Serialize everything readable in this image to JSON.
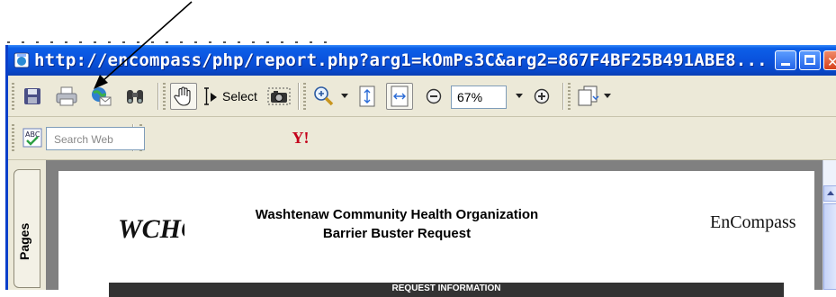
{
  "window": {
    "title": "http://encompass/php/report.php?arg1=kOmPs3C&arg2=867F4BF25B491ABE8..."
  },
  "toolbar1": {
    "select_label": "Select",
    "zoom_value": "67%"
  },
  "toolbar2": {
    "search_placeholder": "Search Web",
    "yahoo_label": "Y!"
  },
  "sidebar": {
    "pages_tab": "Pages"
  },
  "document": {
    "who_logo": "WCHO",
    "org_name": "Washtenaw Community Health Organization",
    "request_title": "Barrier Buster Request",
    "encompass_logo": "EnCompass",
    "section_header": "REQUEST INFORMATION"
  },
  "colors": {
    "titlebar": "#0a52dd",
    "chrome": "#ece9d8",
    "doc_background": "#808080"
  }
}
